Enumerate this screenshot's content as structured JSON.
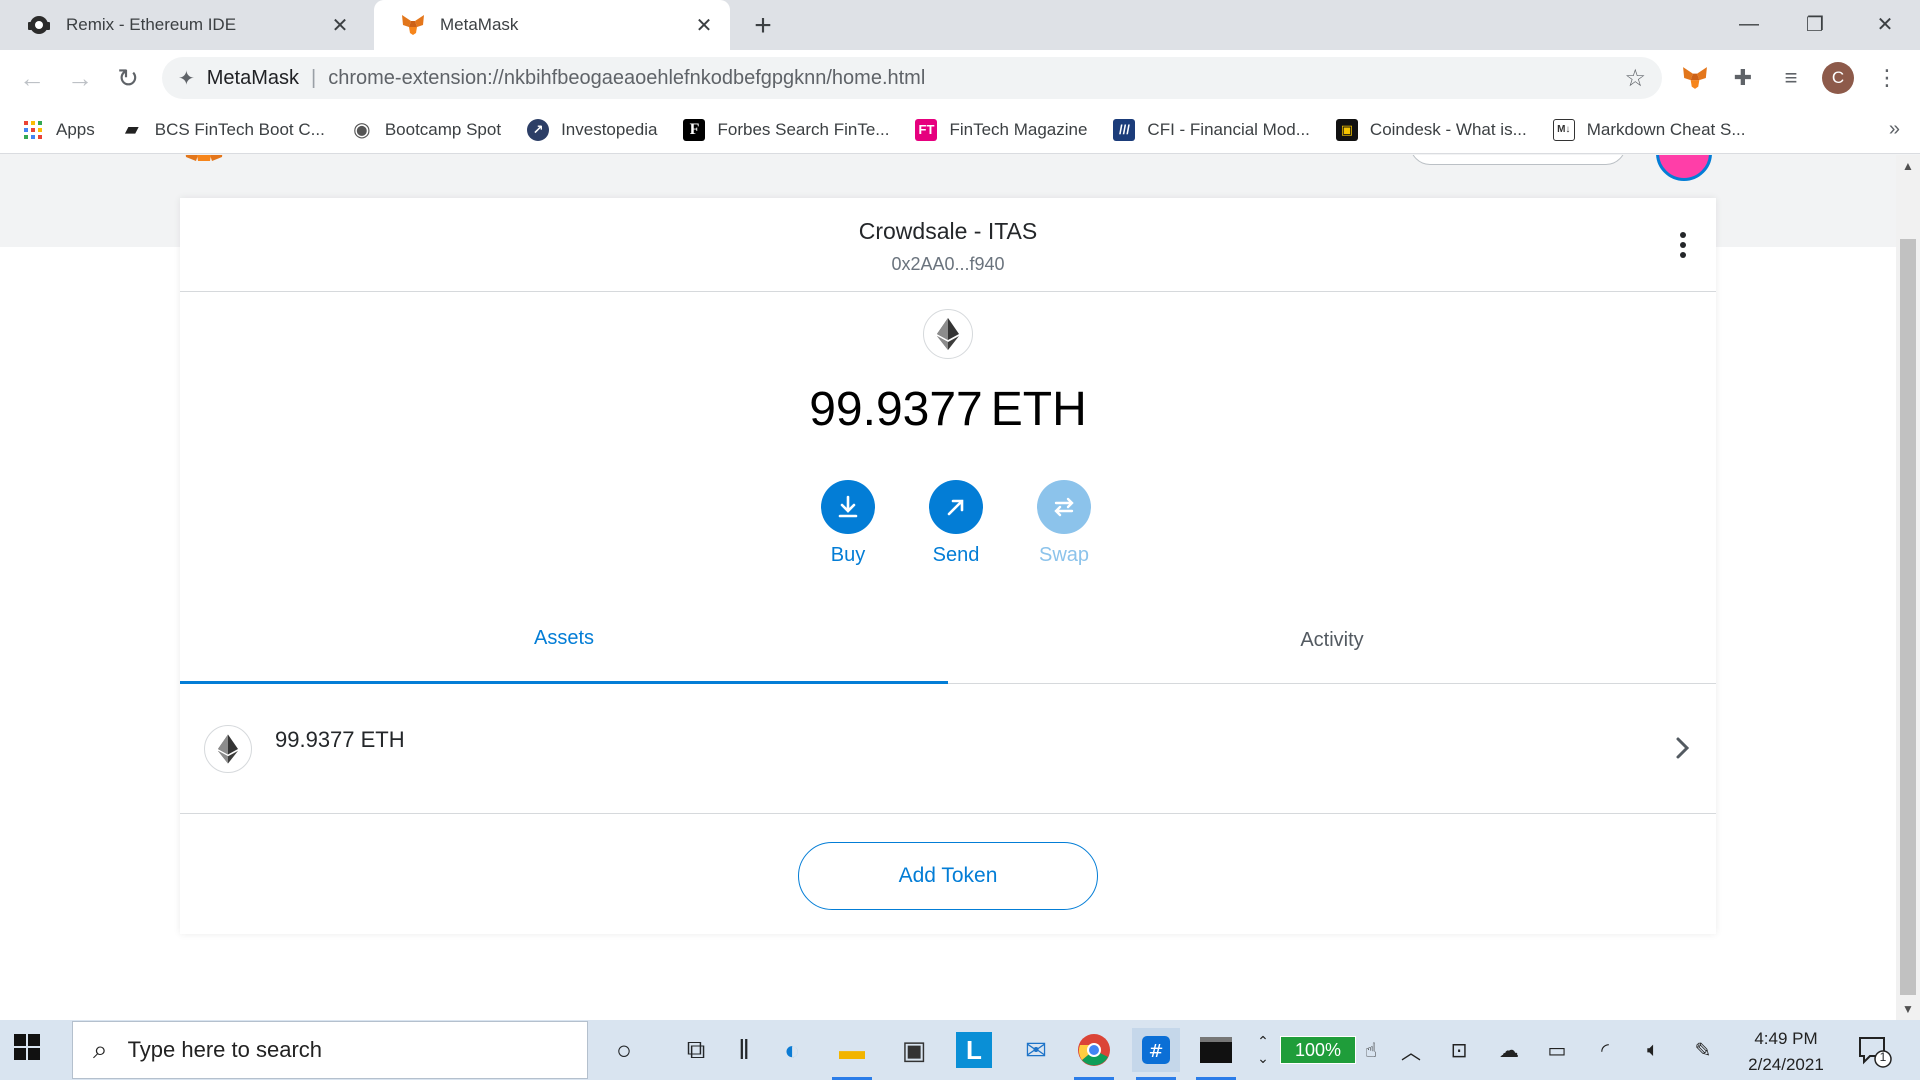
{
  "browser": {
    "tabs": [
      {
        "title": "Remix - Ethereum IDE",
        "icon": "remix-icon",
        "active": false
      },
      {
        "title": "MetaMask",
        "icon": "metamask-fox-icon",
        "active": true
      }
    ],
    "new_tab_label": "+",
    "omnibox": {
      "extension_name": "MetaMask",
      "url": "chrome-extension://nkbihfbeogaeaoehlefnkodbefgpgknn/home.html"
    },
    "profile_initial": "C",
    "bookmarks": [
      {
        "label": "Apps",
        "icon": "apps-grid-icon"
      },
      {
        "label": "BCS FinTech Boot C...",
        "icon": "book-icon"
      },
      {
        "label": "Bootcamp Spot",
        "icon": "globe-icon"
      },
      {
        "label": "Investopedia",
        "icon": "investopedia-icon"
      },
      {
        "label": "Forbes Search FinTe...",
        "icon": "forbes-icon"
      },
      {
        "label": "FinTech Magazine",
        "icon": "ft-icon"
      },
      {
        "label": "CFI - Financial Mod...",
        "icon": "cfi-icon"
      },
      {
        "label": "Coindesk - What is...",
        "icon": "coindesk-icon"
      },
      {
        "label": "Markdown Cheat S...",
        "icon": "markdown-icon"
      }
    ],
    "bookmarks_overflow": "»"
  },
  "wallet": {
    "account_name": "Crowdsale - ITAS",
    "account_address": "0x2AA0...f940",
    "balance_amount": "99.9377",
    "balance_currency": "ETH",
    "actions": {
      "buy": "Buy",
      "send": "Send",
      "swap": "Swap"
    },
    "tabs": {
      "assets": "Assets",
      "activity": "Activity"
    },
    "asset_row": {
      "amount": "99.9377 ETH"
    },
    "add_token_label": "Add Token",
    "colors": {
      "primary": "#037dd6",
      "disabled": "#8cc3eb"
    }
  },
  "taskbar": {
    "search_placeholder": "Type here to search",
    "battery_percent": "100%",
    "time": "4:49 PM",
    "date": "2/24/2021",
    "notification_count": "1"
  }
}
